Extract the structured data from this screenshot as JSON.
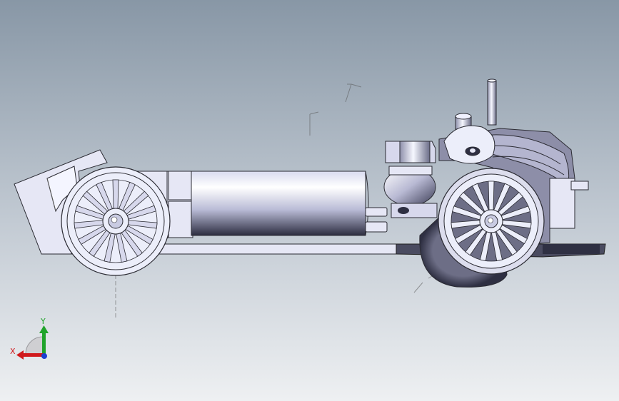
{
  "viewport": {
    "background_top": "#8a9aa9",
    "background_bottom": "#e9ecef",
    "model_fill": "#e6e7f5",
    "model_stroke": "#2b2b33",
    "model_shade_dark": "#7d7e96",
    "model_shade_light": "#ffffff"
  },
  "triad": {
    "x_label": "X",
    "y_label": "Y",
    "x_color": "#d0191c",
    "y_color": "#1fa32a",
    "z_color": "#1b3fd1"
  },
  "icons": {
    "model": "chassis-model-icon",
    "triad": "coordinate-triad-icon"
  }
}
